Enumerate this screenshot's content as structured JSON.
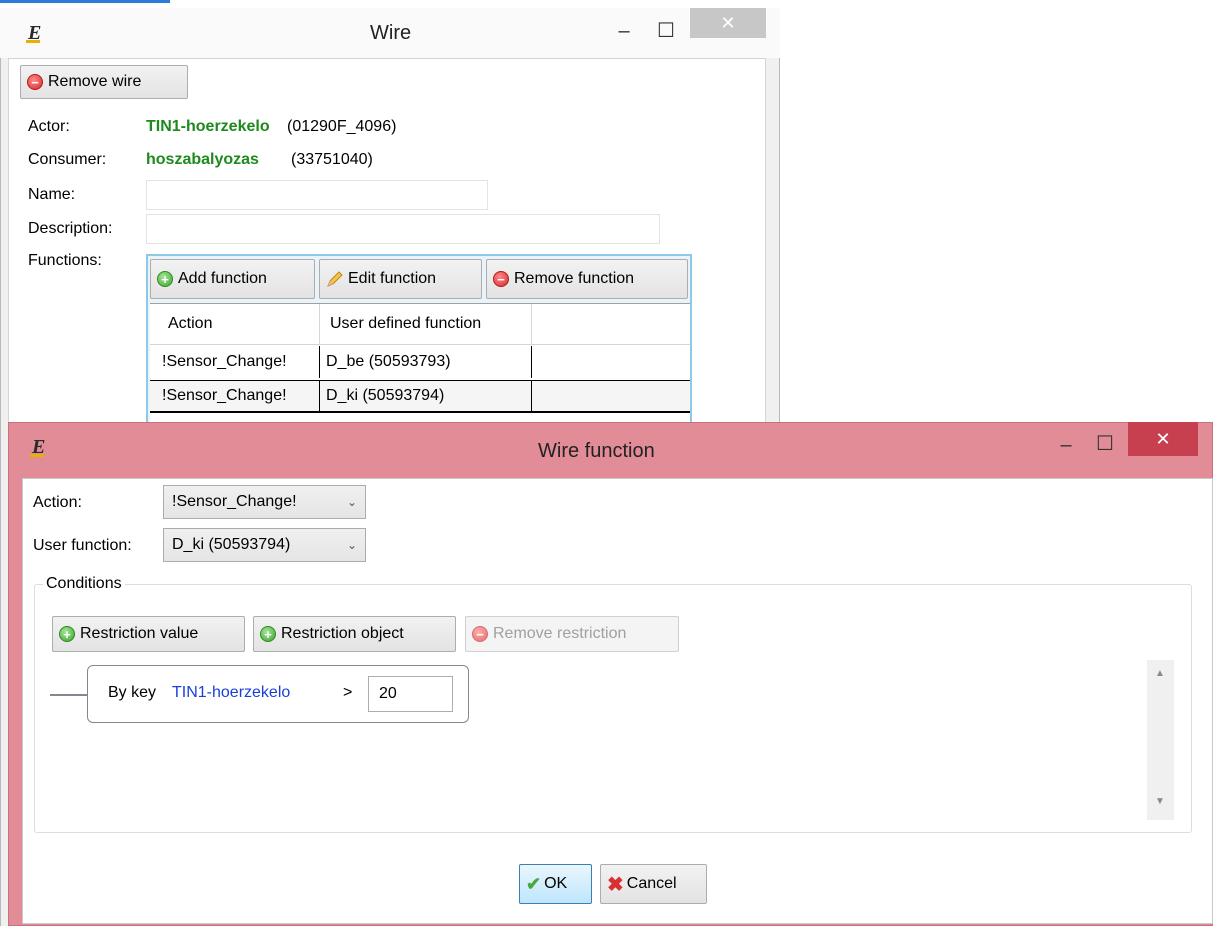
{
  "wire_window": {
    "title": "Wire",
    "remove_wire_label": "Remove wire",
    "actor_label": "Actor:",
    "actor_name": "TIN1-hoerzekelo",
    "actor_id": "(01290F_4096)",
    "consumer_label": "Consumer:",
    "consumer_name": "hoszabalyozas",
    "consumer_id": "(33751040)",
    "name_label": "Name:",
    "name_value": "",
    "description_label": "Description:",
    "description_value": "",
    "functions_label": "Functions:",
    "add_function_label": "Add function",
    "edit_function_label": "Edit function",
    "remove_function_label": "Remove function",
    "columns": [
      "Action",
      "User defined function"
    ],
    "rows": [
      {
        "action": "!Sensor_Change!",
        "function": "D_be (50593793)"
      },
      {
        "action": "!Sensor_Change!",
        "function": "D_ki (50593794)"
      }
    ],
    "controls": {
      "minimize": "–",
      "maximize": "☐",
      "close": "✕"
    }
  },
  "wire_function_dialog": {
    "title": "Wire function",
    "action_label": "Action:",
    "action_value": "!Sensor_Change!",
    "user_function_label": "User function:",
    "user_function_value": "D_ki (50593794)",
    "conditions_label": "Conditions",
    "restriction_value_label": "Restriction value",
    "restriction_object_label": "Restriction object",
    "remove_restriction_label": "Remove restriction",
    "condition": {
      "prefix": "By key",
      "key": "TIN1-hoerzekelo",
      "operator": ">",
      "value": "20"
    },
    "ok_label": "OK",
    "cancel_label": "Cancel",
    "controls": {
      "minimize": "–",
      "maximize": "☐",
      "close": "✕"
    }
  },
  "colors": {
    "dialog_border": "#e28c98",
    "link_green": "#1e8a1e",
    "key_blue": "#1a3fd8",
    "close_red": "#c7404f"
  }
}
